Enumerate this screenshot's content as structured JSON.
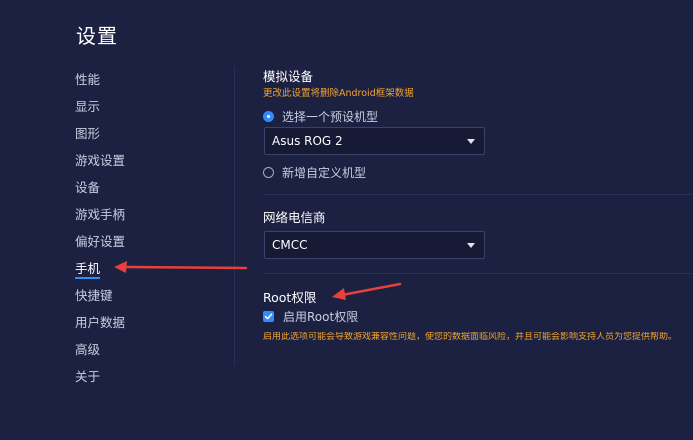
{
  "page_title": "设置",
  "sidebar": {
    "items": [
      {
        "label": "性能"
      },
      {
        "label": "显示"
      },
      {
        "label": "图形"
      },
      {
        "label": "游戏设置"
      },
      {
        "label": "设备"
      },
      {
        "label": "游戏手柄"
      },
      {
        "label": "偏好设置"
      },
      {
        "label": "手机"
      },
      {
        "label": "快捷键"
      },
      {
        "label": "用户数据"
      },
      {
        "label": "高级"
      },
      {
        "label": "关于"
      }
    ],
    "active_label": "手机"
  },
  "device": {
    "title": "模拟设备",
    "warning": "更改此设置将删除Android框架数据",
    "preset_option": "选择一个预设机型",
    "preset_value": "Asus ROG 2",
    "custom_option": "新增自定义机型"
  },
  "carrier": {
    "title": "网络电信商",
    "value": "CMCC"
  },
  "root": {
    "title": "Root权限",
    "checkbox_label": "启用Root权限",
    "checked": true,
    "warning": "启用此选项可能会导致游戏兼容性问题，使您的数据面临风险，并且可能会影响支持人员为您提供帮助。"
  },
  "colors": {
    "background": "#1d2141",
    "accent": "#2f8cff",
    "warning": "#f0a431",
    "annotation_arrow": "#e8403a"
  }
}
